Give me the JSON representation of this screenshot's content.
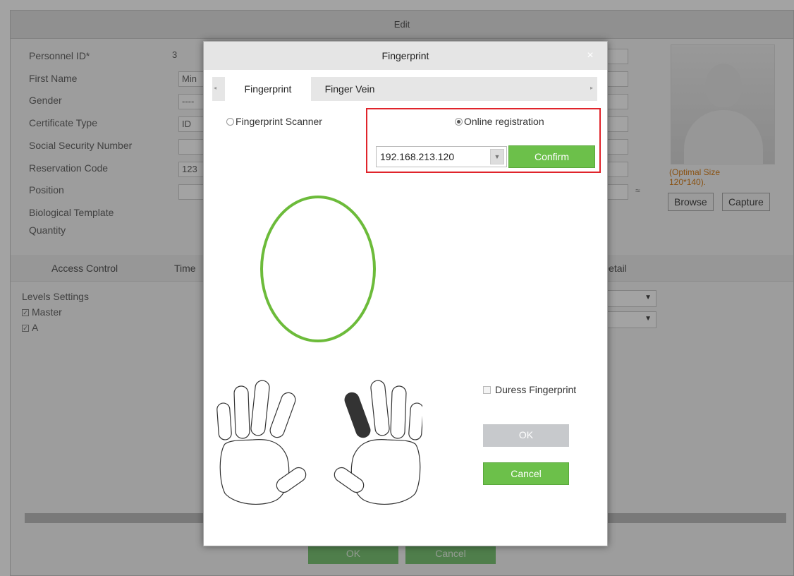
{
  "background_window": {
    "title": "Edit",
    "form_labels": [
      "Personnel ID*",
      "First Name",
      "Gender",
      "Certificate Type",
      "Social Security Number",
      "Reservation Code",
      "Position",
      "Biological Template",
      "Quantity"
    ],
    "values": {
      "personnel_id": "3",
      "first_name": "Min",
      "gender": "----",
      "certificate_type": "ID",
      "reservation_code": "123"
    },
    "photo": {
      "size_note_line1": "(Optimal Size",
      "size_note_line2": "120*140).",
      "browse": "Browse",
      "capture": "Capture"
    },
    "tabs": [
      "Access Control",
      "Time",
      "Detail"
    ],
    "levels": {
      "heading": "Levels Settings",
      "items": [
        "Master",
        "A"
      ]
    },
    "footer": {
      "ok": "OK",
      "cancel": "Cancel"
    }
  },
  "dialog": {
    "title": "Fingerprint",
    "close_glyph": "×",
    "tabs": [
      {
        "label": "Fingerprint",
        "active": true
      },
      {
        "label": "Finger Vein",
        "active": false
      }
    ],
    "options": {
      "scanner_label": "Fingerprint Scanner",
      "online_label": "Online registration",
      "selected": "Online registration"
    },
    "ip_select": {
      "value": "192.168.213.120"
    },
    "confirm_label": "Confirm",
    "duress_label": "Duress Fingerprint",
    "ok_label": "OK",
    "cancel_label": "Cancel",
    "selected_finger": "right-index"
  },
  "colors": {
    "accent_green": "#6cc04a",
    "highlight_red": "#e0242b",
    "oval_green": "#6cbb3a"
  }
}
